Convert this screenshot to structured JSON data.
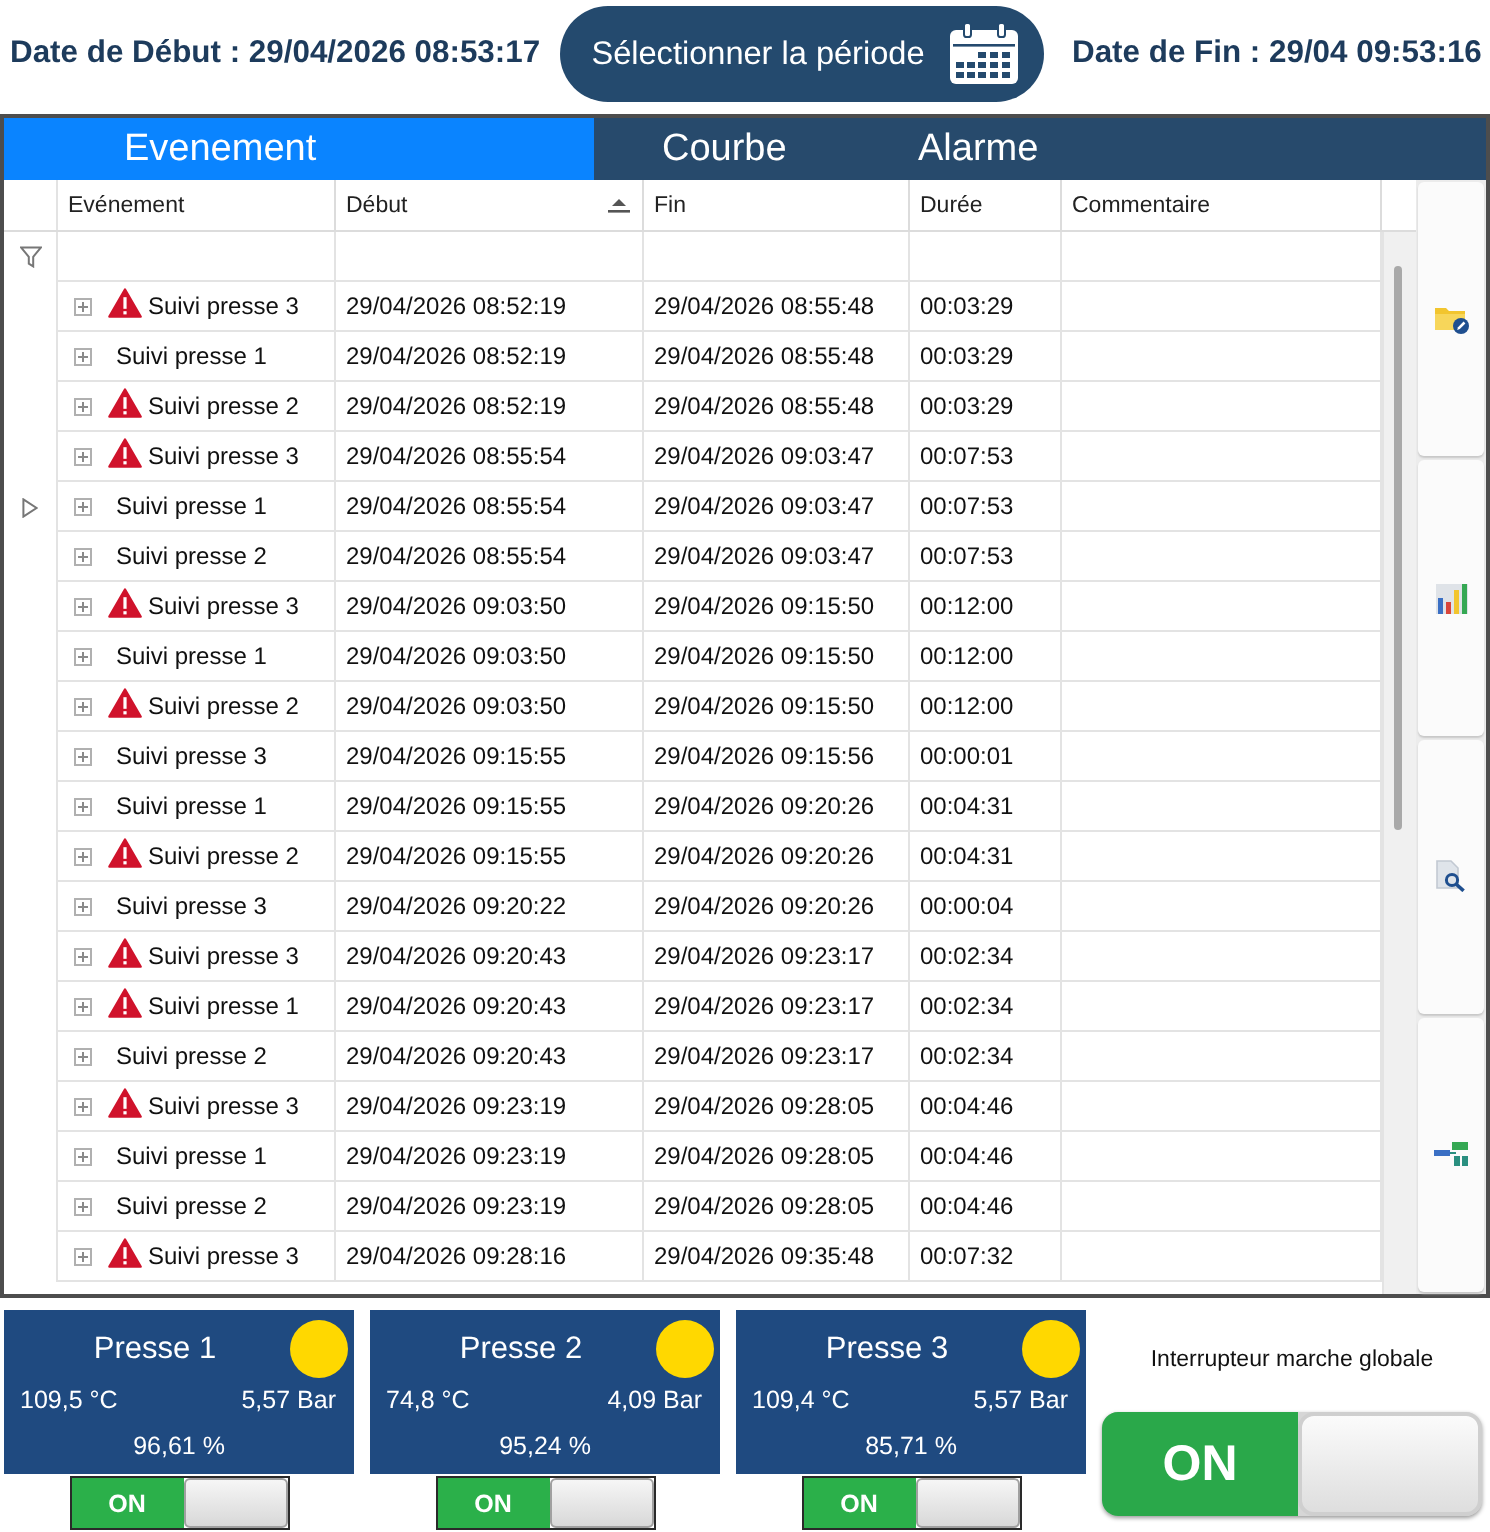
{
  "header": {
    "start_label": "Date de Début : 29/04/2026 08:53:17",
    "period_button": "Sélectionner la période",
    "end_label": "Date de Fin : 29/04 09:53:16"
  },
  "tabs": [
    {
      "label": "Evenement",
      "selected": true
    },
    {
      "label": "Courbe",
      "selected": false
    },
    {
      "label": "Alarme",
      "selected": false
    }
  ],
  "grid": {
    "columns": [
      {
        "label": "Evénement",
        "sorted": false
      },
      {
        "label": "Début",
        "sorted": true
      },
      {
        "label": "Fin",
        "sorted": false
      },
      {
        "label": "Durée",
        "sorted": false
      },
      {
        "label": "Commentaire",
        "sorted": false
      }
    ],
    "rows": [
      {
        "alarm": true,
        "expanded": false,
        "selected": false,
        "cells": [
          "Suivi presse 3",
          "29/04/2026 08:52:19",
          "29/04/2026 08:55:48",
          "00:03:29"
        ]
      },
      {
        "alarm": false,
        "expanded": false,
        "selected": false,
        "cells": [
          "Suivi presse 1",
          "29/04/2026 08:52:19",
          "29/04/2026 08:55:48",
          "00:03:29"
        ]
      },
      {
        "alarm": true,
        "expanded": false,
        "selected": false,
        "cells": [
          "Suivi presse 2",
          "29/04/2026 08:52:19",
          "29/04/2026 08:55:48",
          "00:03:29"
        ]
      },
      {
        "alarm": true,
        "expanded": false,
        "selected": false,
        "cells": [
          "Suivi presse 3",
          "29/04/2026 08:55:54",
          "29/04/2026 09:03:47",
          "00:07:53"
        ]
      },
      {
        "alarm": false,
        "expanded": false,
        "selected": true,
        "cells": [
          "Suivi presse 1",
          "29/04/2026 08:55:54",
          "29/04/2026 09:03:47",
          "00:07:53"
        ]
      },
      {
        "alarm": false,
        "expanded": false,
        "selected": false,
        "cells": [
          "Suivi presse 2",
          "29/04/2026 08:55:54",
          "29/04/2026 09:03:47",
          "00:07:53"
        ]
      },
      {
        "alarm": true,
        "expanded": false,
        "selected": false,
        "cells": [
          "Suivi presse 3",
          "29/04/2026 09:03:50",
          "29/04/2026 09:15:50",
          "00:12:00"
        ]
      },
      {
        "alarm": false,
        "expanded": false,
        "selected": false,
        "cells": [
          "Suivi presse 1",
          "29/04/2026 09:03:50",
          "29/04/2026 09:15:50",
          "00:12:00"
        ]
      },
      {
        "alarm": true,
        "expanded": false,
        "selected": false,
        "cells": [
          "Suivi presse 2",
          "29/04/2026 09:03:50",
          "29/04/2026 09:15:50",
          "00:12:00"
        ]
      },
      {
        "alarm": false,
        "expanded": false,
        "selected": false,
        "cells": [
          "Suivi presse 3",
          "29/04/2026 09:15:55",
          "29/04/2026 09:15:56",
          "00:00:01"
        ]
      },
      {
        "alarm": false,
        "expanded": false,
        "selected": false,
        "cells": [
          "Suivi presse 1",
          "29/04/2026 09:15:55",
          "29/04/2026 09:20:26",
          "00:04:31"
        ]
      },
      {
        "alarm": true,
        "expanded": false,
        "selected": false,
        "cells": [
          "Suivi presse 2",
          "29/04/2026 09:15:55",
          "29/04/2026 09:20:26",
          "00:04:31"
        ]
      },
      {
        "alarm": false,
        "expanded": false,
        "selected": false,
        "cells": [
          "Suivi presse 3",
          "29/04/2026 09:20:22",
          "29/04/2026 09:20:26",
          "00:00:04"
        ]
      },
      {
        "alarm": true,
        "expanded": false,
        "selected": false,
        "cells": [
          "Suivi presse 3",
          "29/04/2026 09:20:43",
          "29/04/2026 09:23:17",
          "00:02:34"
        ]
      },
      {
        "alarm": true,
        "expanded": false,
        "selected": false,
        "cells": [
          "Suivi presse 1",
          "29/04/2026 09:20:43",
          "29/04/2026 09:23:17",
          "00:02:34"
        ]
      },
      {
        "alarm": false,
        "expanded": false,
        "selected": false,
        "cells": [
          "Suivi presse 2",
          "29/04/2026 09:20:43",
          "29/04/2026 09:23:17",
          "00:02:34"
        ]
      },
      {
        "alarm": true,
        "expanded": false,
        "selected": false,
        "cells": [
          "Suivi presse 3",
          "29/04/2026 09:23:19",
          "29/04/2026 09:28:05",
          "00:04:46"
        ]
      },
      {
        "alarm": false,
        "expanded": false,
        "selected": false,
        "cells": [
          "Suivi presse 1",
          "29/04/2026 09:23:19",
          "29/04/2026 09:28:05",
          "00:04:46"
        ]
      },
      {
        "alarm": false,
        "expanded": false,
        "selected": false,
        "cells": [
          "Suivi presse 2",
          "29/04/2026 09:23:19",
          "29/04/2026 09:28:05",
          "00:04:46"
        ]
      },
      {
        "alarm": true,
        "expanded": false,
        "selected": false,
        "cells": [
          "Suivi presse 3",
          "29/04/2026 09:28:16",
          "29/04/2026 09:35:48",
          "00:07:32"
        ]
      }
    ]
  },
  "side_toolbar": [
    {
      "kind": "folder"
    },
    {
      "kind": "chart"
    },
    {
      "kind": "preview"
    },
    {
      "kind": "diagram"
    }
  ],
  "presses": [
    {
      "name": "Presse 1",
      "color": "#ffd800",
      "temperature": "109,5 °C",
      "pressure": "5,57 Bar",
      "rate": "96,61 %",
      "switch": {
        "label": "ON",
        "on": true
      }
    },
    {
      "name": "Presse 2",
      "color": "#ffd800",
      "temperature": "74,8 °C",
      "pressure": "4,09 Bar",
      "rate": "95,24 %",
      "switch": {
        "label": "ON",
        "on": true
      }
    },
    {
      "name": "Presse 3",
      "color": "#ffd800",
      "temperature": "109,4 °C",
      "pressure": "5,57 Bar",
      "rate": "85,71 %",
      "switch": {
        "label": "ON",
        "on": true
      }
    }
  ],
  "global_switch": {
    "title": "Interrupteur marche globale",
    "label": "ON",
    "on": true
  }
}
